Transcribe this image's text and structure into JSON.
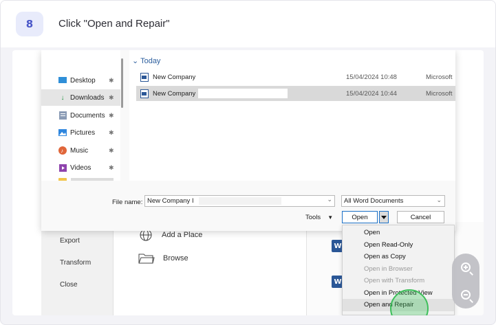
{
  "header": {
    "step_number": "8",
    "instruction": "Click \"Open and Repair\""
  },
  "backstage": {
    "left_menu": [
      "Export",
      "Transform",
      "Close"
    ],
    "places": [
      {
        "label": "Add a Place",
        "icon": "globe-icon"
      },
      {
        "label": "Browse",
        "icon": "folder-icon"
      }
    ]
  },
  "dialog": {
    "nav_items": [
      {
        "label": "Desktop",
        "icon": "desktop-icon",
        "color": "#2f8fd8"
      },
      {
        "label": "Downloads",
        "icon": "download-icon",
        "color": "#1a8f3c",
        "selected": true
      },
      {
        "label": "Documents",
        "icon": "documents-icon",
        "color": "#7c8aa0"
      },
      {
        "label": "Pictures",
        "icon": "pictures-icon",
        "color": "#2e86de"
      },
      {
        "label": "Music",
        "icon": "music-icon",
        "color": "#e0663a"
      },
      {
        "label": "Videos",
        "icon": "videos-icon",
        "color": "#8e44ad"
      }
    ],
    "group_header": "Today",
    "files": [
      {
        "name": "New Company",
        "date": "15/04/2024 10:48",
        "type": "Microsoft"
      },
      {
        "name": "New Company",
        "date": "15/04/2024 10:44",
        "type": "Microsoft",
        "selected": true
      }
    ],
    "file_name_label": "File name:",
    "file_name_value": "New Company I",
    "filter": "All Word Documents",
    "tools_label": "Tools",
    "open_label": "Open",
    "cancel_label": "Cancel"
  },
  "open_menu": [
    {
      "label": "Open",
      "enabled": true
    },
    {
      "label": "Open Read-Only",
      "enabled": true
    },
    {
      "label": "Open as Copy",
      "enabled": true
    },
    {
      "label": "Open in Browser",
      "enabled": false
    },
    {
      "label": "Open with Transform",
      "enabled": false
    },
    {
      "label": "Open in Protected View",
      "enabled": true
    },
    {
      "label": "Open and Repair",
      "enabled": true,
      "highlighted": true
    }
  ],
  "colors": {
    "accent": "#4a57c8",
    "click_indicator": "#3dbf5a",
    "selection_border": "#1a6fc6"
  }
}
